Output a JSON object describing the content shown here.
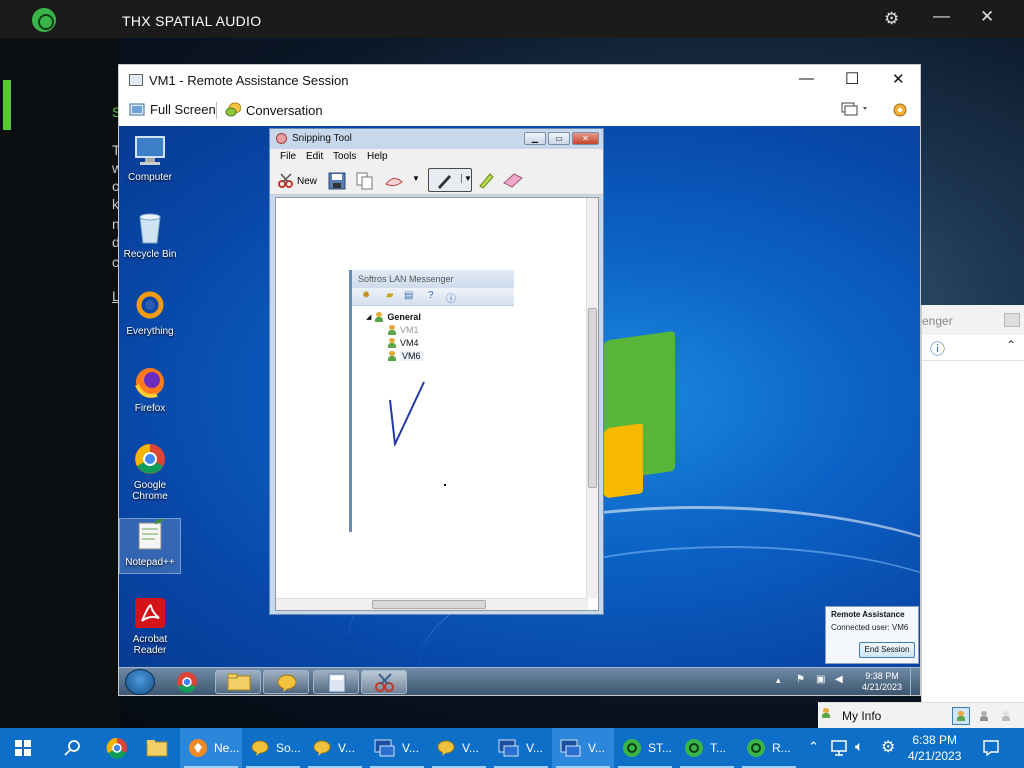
{
  "host_app": {
    "title": "THX SPATIAL AUDIO",
    "settings_icon": "gear-icon",
    "minimize_icon": "minimize-icon",
    "close_icon": "close-icon",
    "side_text": [
      "S",
      "T",
      "w",
      "c",
      "k",
      "n",
      "d",
      "c",
      "L"
    ]
  },
  "ra_window": {
    "title": "VM1 - Remote Assistance Session",
    "toolbar": {
      "full_screen": "Full Screen",
      "conversation": "Conversation"
    }
  },
  "remote_desktop": {
    "icons": [
      {
        "label": "Computer",
        "icon": "computer-icon"
      },
      {
        "label": "Recycle Bin",
        "icon": "recycle-bin-icon"
      },
      {
        "label": "Everything",
        "icon": "everything-icon"
      },
      {
        "label": "Firefox",
        "icon": "firefox-icon"
      },
      {
        "label": "Google Chrome",
        "icon": "chrome-icon"
      },
      {
        "label": "Notepad++",
        "icon": "notepad-icon"
      },
      {
        "label": "Acrobat Reader",
        "icon": "acrobat-icon"
      }
    ],
    "snipping_tool": {
      "title": "Snipping Tool",
      "menu": [
        "File",
        "Edit",
        "Tools",
        "Help"
      ],
      "new_label": "New",
      "captured": {
        "title": "Softros LAN Messenger",
        "group": "General",
        "users": [
          "VM1",
          "VM4",
          "VM6"
        ]
      }
    },
    "ra_popup": {
      "title": "Remote Assistance",
      "status": "Connected user: VM6",
      "end_button": "End Session"
    },
    "taskbar_clock": {
      "time": "9:38 PM",
      "date": "4/21/2023"
    }
  },
  "lan_fragment": {
    "header": "enger",
    "footer_label": "My Info"
  },
  "host_taskbar": {
    "items": [
      {
        "label": "Ne...",
        "icon": "browser-icon"
      },
      {
        "label": "So...",
        "icon": "messenger-icon"
      },
      {
        "label": "V...",
        "icon": "messenger-icon"
      },
      {
        "label": "V...",
        "icon": "remote-assistance-icon"
      },
      {
        "label": "V...",
        "icon": "messenger-icon"
      },
      {
        "label": "V...",
        "icon": "remote-assistance-icon"
      },
      {
        "label": "V...",
        "icon": "remote-assistance-icon"
      },
      {
        "label": "ST...",
        "icon": "thx-icon"
      },
      {
        "label": "T...",
        "icon": "thx-icon"
      },
      {
        "label": "R...",
        "icon": "thx-icon"
      }
    ],
    "clock": {
      "time": "6:38 PM",
      "date": "4/21/2023"
    }
  }
}
